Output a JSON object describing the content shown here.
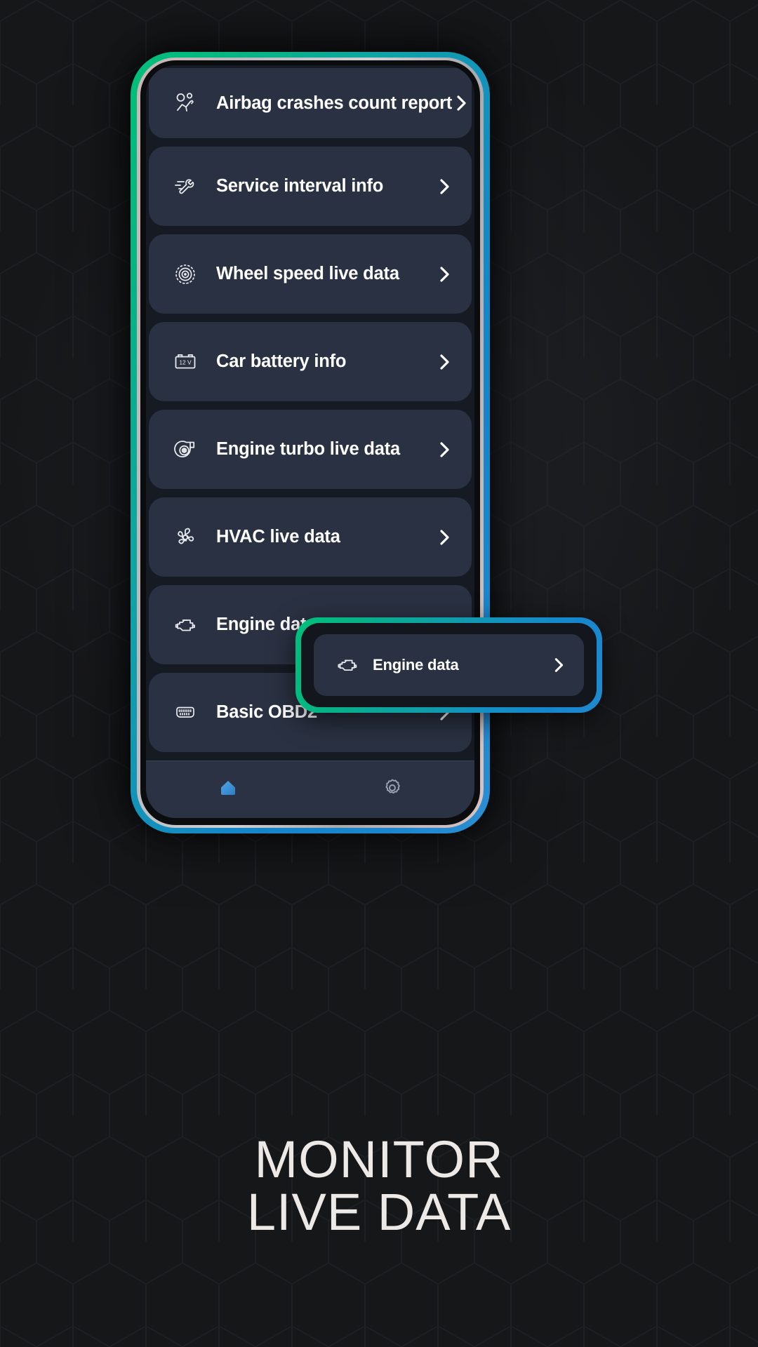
{
  "headline": {
    "line1": "MONITOR",
    "line2": "LIVE DATA"
  },
  "colors": {
    "bezel_start": "#00c07a",
    "bezel_end": "#2b8fd4",
    "card_bg": "#2a3142",
    "screen_bg": "#161a23",
    "page_bg": "#161719",
    "nav_active": "#3e90db",
    "nav_inactive": "#9aa3b4",
    "label": "#ffffff",
    "headline": "#ece9e6"
  },
  "screen": {
    "list": [
      {
        "label": "Airbag crashes count report",
        "icon": "airbag-crash-icon",
        "chevron": "chevron-right-icon"
      },
      {
        "label": "Service interval info",
        "icon": "wrench-service-icon",
        "chevron": "chevron-right-icon"
      },
      {
        "label": "Wheel speed live data",
        "icon": "wheel-speed-icon",
        "chevron": "chevron-right-icon"
      },
      {
        "label": "Car battery info",
        "icon": "car-battery-icon",
        "icon_text": "12 V",
        "chevron": "chevron-right-icon"
      },
      {
        "label": "Engine turbo live data",
        "icon": "turbocharger-icon",
        "chevron": "chevron-right-icon"
      },
      {
        "label": "HVAC live data",
        "icon": "fan-icon",
        "chevron": "chevron-right-icon"
      },
      {
        "label": "Engine data",
        "icon": "engine-icon",
        "chevron": "chevron-right-icon"
      },
      {
        "label": "Basic OBD2",
        "icon": "obd2-connector-icon",
        "chevron": "chevron-right-icon"
      }
    ],
    "bottom_nav": [
      {
        "name": "home",
        "icon": "home-icon",
        "active": true
      },
      {
        "name": "settings",
        "icon": "gear-icon",
        "active": false
      }
    ]
  },
  "callout": {
    "label": "Engine data",
    "icon": "engine-icon",
    "chevron": "chevron-right-icon"
  }
}
